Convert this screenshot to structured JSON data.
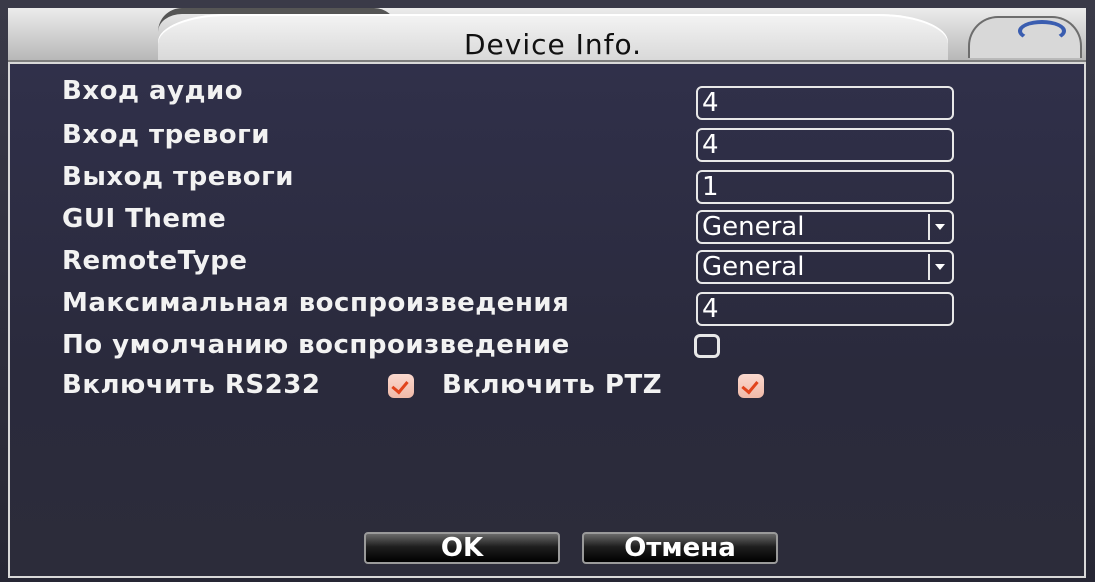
{
  "dialog": {
    "title": "Device Info."
  },
  "rows": {
    "audio_in": {
      "label": "Вход аудио",
      "value": "4"
    },
    "alarm_in": {
      "label": "Вход тревоги",
      "value": "4"
    },
    "alarm_out": {
      "label": "Выход тревоги",
      "value": "1"
    },
    "gui_theme": {
      "label": "GUI Theme",
      "value": "General"
    },
    "remote_type": {
      "label": "RemoteType",
      "value": "General"
    },
    "max_playback": {
      "label": "Максимальная воспроизведения",
      "value": "4"
    },
    "default_playback": {
      "label": "По умолчанию воспроизведение",
      "checked": false
    },
    "rs232": {
      "label": "Включить RS232",
      "checked": true
    },
    "ptz": {
      "label": "Включить PTZ",
      "checked": true
    }
  },
  "buttons": {
    "ok": "OK",
    "cancel": "Отмена"
  },
  "colors": {
    "checkbox_checked": "#f0b9a8",
    "checkmark": "#e1441c"
  }
}
